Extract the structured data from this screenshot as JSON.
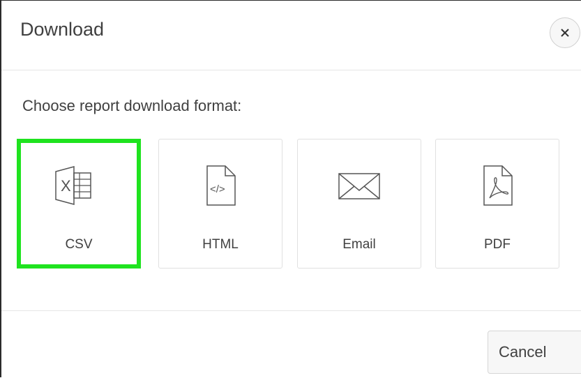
{
  "dialog": {
    "title": "Download",
    "close_icon": "close-icon"
  },
  "body": {
    "prompt": "Choose report download format:",
    "formats": [
      {
        "label": "CSV",
        "icon": "spreadsheet-csv-icon",
        "selected": true
      },
      {
        "label": "HTML",
        "icon": "html-file-icon",
        "selected": false
      },
      {
        "label": "Email",
        "icon": "envelope-icon",
        "selected": false
      },
      {
        "label": "PDF",
        "icon": "pdf-file-icon",
        "selected": false
      }
    ]
  },
  "footer": {
    "cancel_label": "Cancel"
  },
  "colors": {
    "selected_border": "#1fe31f",
    "text": "#404040",
    "divider": "#e6e6e6"
  }
}
